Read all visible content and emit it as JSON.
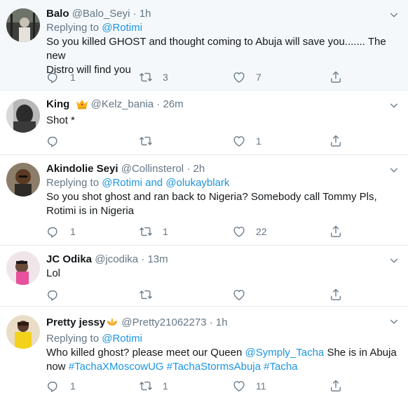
{
  "tweets": [
    {
      "name": "Balo",
      "handle": "@Balo_Seyi",
      "dot": "·",
      "time": "1h",
      "replying_prefix": "Replying to ",
      "replying_to": "@Rotimi",
      "text1": "So you killed GHOST and thought coming to Abuja will save you....... The new",
      "text2": "Distro will find you",
      "replies": "1",
      "retweets": "3",
      "likes": "7"
    },
    {
      "name": "King",
      "handle": "@Kelz_bania",
      "dot": "·",
      "time": "26m",
      "text1": "Shot *",
      "likes": "1",
      "emoji": "crown-emoji"
    },
    {
      "name": "Akindolie Seyi",
      "handle": "@Collinsterol",
      "dot": "·",
      "time": "2h",
      "replying_prefix": "Replying to ",
      "replying_to": "@Rotimi",
      "replying_and": " and ",
      "replying_to2": "@olukayblark",
      "text1": "So you shot ghost and ran back to Nigeria? Somebody call Tommy Pls,",
      "text2": "Rotimi is in Nigeria",
      "replies": "1",
      "retweets": "1",
      "likes": "22"
    },
    {
      "name": "JC Odika",
      "handle": "@jcodika",
      "dot": "·",
      "time": "13m",
      "text1": "Lol"
    },
    {
      "name": "Pretty jessy",
      "handle": "@Pretty21062273",
      "dot": "·",
      "time": "1h",
      "replying_prefix": "Replying to ",
      "replying_to": "@Rotimi",
      "text1_a": "Who killed ghost?  please meet our Queen ",
      "text1_mention": "@Symply_Tacha",
      "text1_b": " She is in Abuja",
      "text2_a": "now  ",
      "hashtag1": "#TachaXMoscowUG",
      "hashtag2": " #TachaStormsAbuja",
      "hashtag3": " #Tacha",
      "replies": "1",
      "retweets": "1",
      "likes": "11",
      "emoji": "lotus-emoji"
    }
  ],
  "colors": {
    "link": "#1b95e0",
    "muted": "#657786",
    "highlight_bg": "#f5f8fa",
    "divider": "#e6ecf0"
  }
}
